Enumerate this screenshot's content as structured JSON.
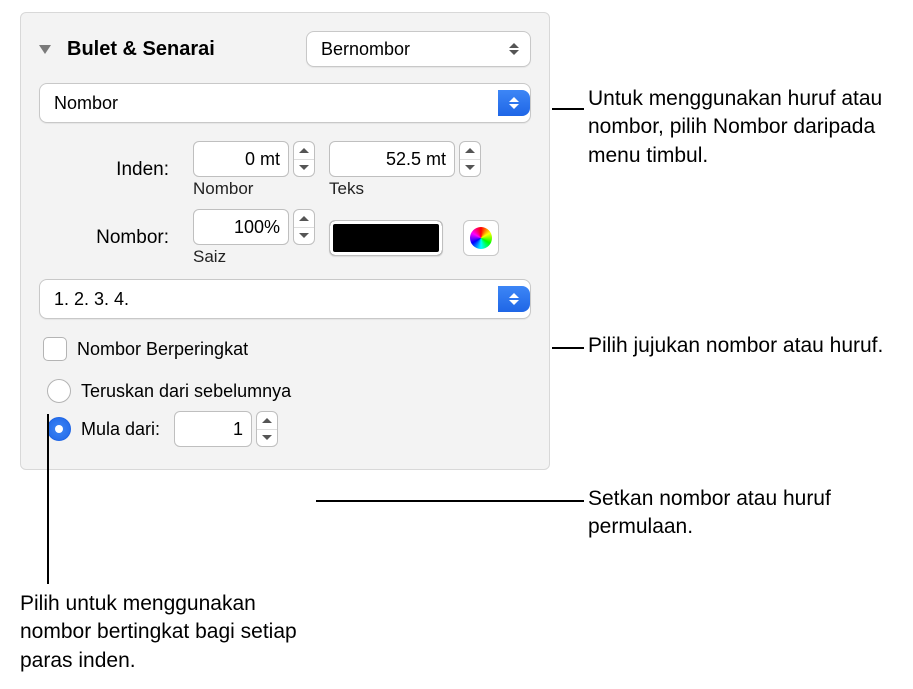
{
  "header": {
    "title": "Bulet & Senarai",
    "style_popup": "Bernombor"
  },
  "type_popup": "Nombor",
  "indent": {
    "label": "Inden:",
    "number_value": "0 mt",
    "number_sublabel": "Nombor",
    "text_value": "52.5 mt",
    "text_sublabel": "Teks"
  },
  "number": {
    "label": "Nombor:",
    "size_value": "100%",
    "size_sublabel": "Saiz"
  },
  "sequence_popup": "1. 2. 3. 4.",
  "tiered_label": "Nombor Berperingkat",
  "continue_label": "Teruskan dari sebelumnya",
  "start_from": {
    "label": "Mula dari:",
    "value": "1"
  },
  "callouts": {
    "type": "Untuk menggunakan huruf atau nombor, pilih Nombor daripada menu timbul.",
    "sequence": "Pilih jujukan nombor atau huruf.",
    "start": "Setkan nombor atau huruf permulaan.",
    "tiered": "Pilih untuk menggunakan nombor bertingkat bagi setiap paras inden."
  }
}
